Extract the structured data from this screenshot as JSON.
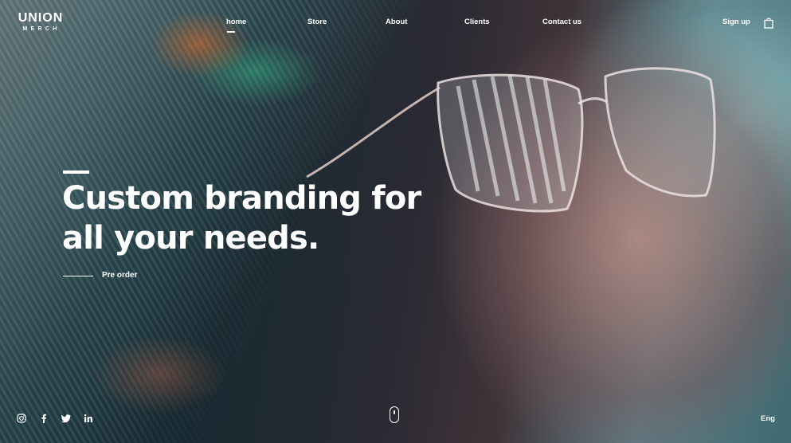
{
  "brand": {
    "name": "UNION",
    "subtitle": "MERCH"
  },
  "nav": {
    "items": [
      {
        "label": "home",
        "active": true
      },
      {
        "label": "Store",
        "active": false
      },
      {
        "label": "About",
        "active": false
      },
      {
        "label": "Clients",
        "active": false
      },
      {
        "label": "Contact us",
        "active": false
      }
    ],
    "signup_label": "Sign up",
    "cart_icon": "shopping-bag-icon"
  },
  "hero": {
    "headline_line1": "Custom branding for",
    "headline_line2": "all your needs.",
    "cta_label": "Pre order"
  },
  "footer": {
    "social": [
      "instagram-icon",
      "facebook-icon",
      "twitter-icon",
      "linkedin-icon"
    ],
    "scroll_indicator": "mouse-scroll-icon",
    "language": "Eng"
  },
  "colors": {
    "text": "#ffffff",
    "accent": "#ffffff"
  }
}
